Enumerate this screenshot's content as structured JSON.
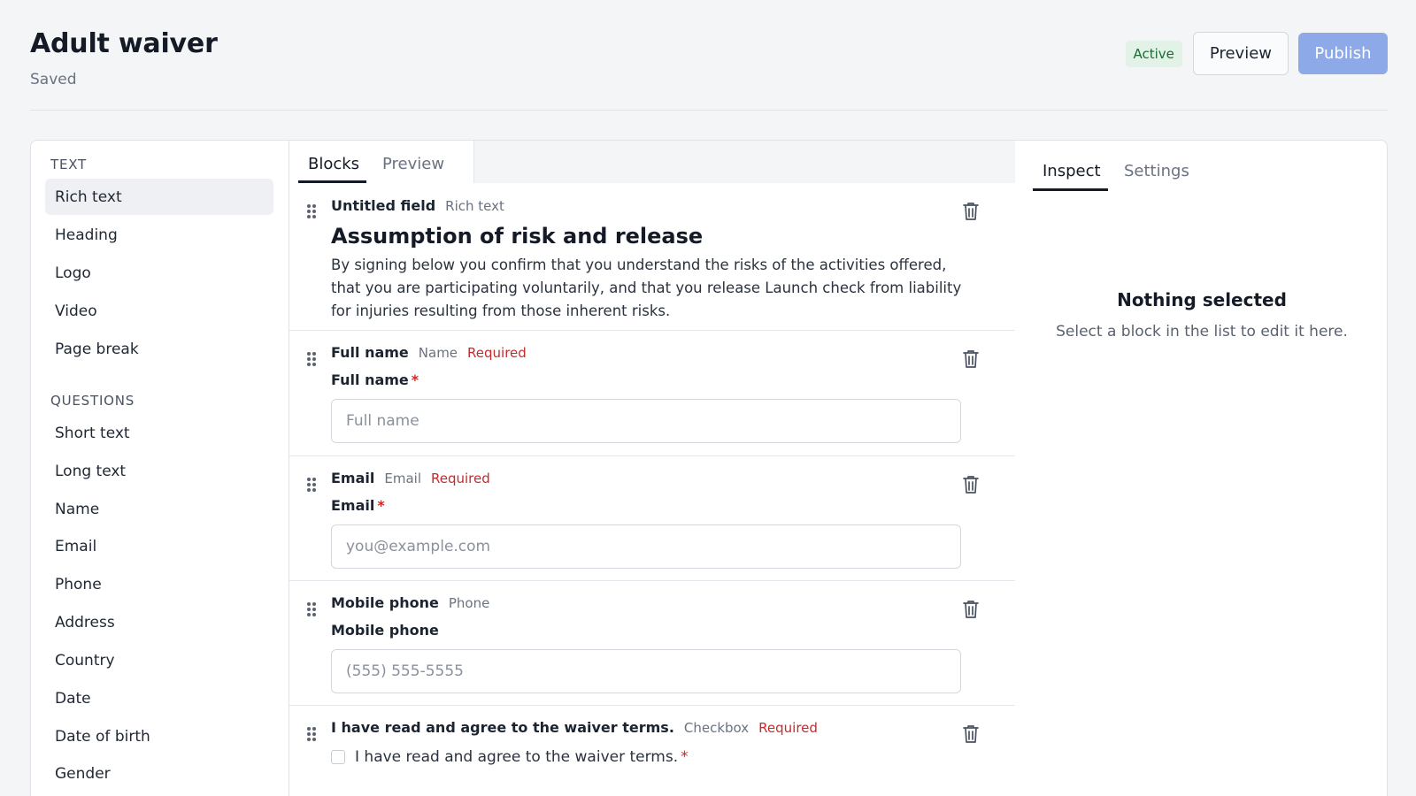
{
  "header": {
    "title": "Adult waiver",
    "subtitle": "Saved",
    "status_badge": "Active",
    "preview_label": "Preview",
    "publish_label": "Publish"
  },
  "palette": {
    "text_section": "TEXT",
    "text_items": [
      "Rich text",
      "Heading",
      "Logo",
      "Video",
      "Page break"
    ],
    "questions_section": "QUESTIONS",
    "question_items": [
      "Short text",
      "Long text",
      "Name",
      "Email",
      "Phone",
      "Address",
      "Country",
      "Date",
      "Date of birth",
      "Gender"
    ]
  },
  "builder": {
    "tabs": [
      "Blocks",
      "Preview"
    ],
    "blocks": [
      {
        "title": "Untitled field",
        "type": "Rich text",
        "heading": "Assumption of risk and release",
        "body": "By signing below you confirm that you understand the risks of the activities offered, that you are participating voluntarily, and that you release Launch check from liability for injuries resulting from those inherent risks."
      },
      {
        "title": "Full name",
        "type": "Name",
        "required": "Required",
        "label": "Full name",
        "star": "*",
        "placeholder": "Full name"
      },
      {
        "title": "Email",
        "type": "Email",
        "required": "Required",
        "label": "Email",
        "star": "*",
        "placeholder": "you@example.com"
      },
      {
        "title": "Mobile phone",
        "type": "Phone",
        "label": "Mobile phone",
        "placeholder": "(555) 555-5555"
      },
      {
        "title": "I have read and agree to the waiver terms.",
        "type": "Checkbox",
        "required": "Required",
        "checkbox_text": "I have read and agree to the waiver terms.",
        "star": "*"
      }
    ]
  },
  "inspector": {
    "tabs": [
      "Inspect",
      "Settings"
    ],
    "empty_title": "Nothing selected",
    "empty_subtitle": "Select a block in the list to edit it here."
  },
  "icons": {
    "drag": "drag-handle-icon",
    "delete": "trash-icon"
  }
}
